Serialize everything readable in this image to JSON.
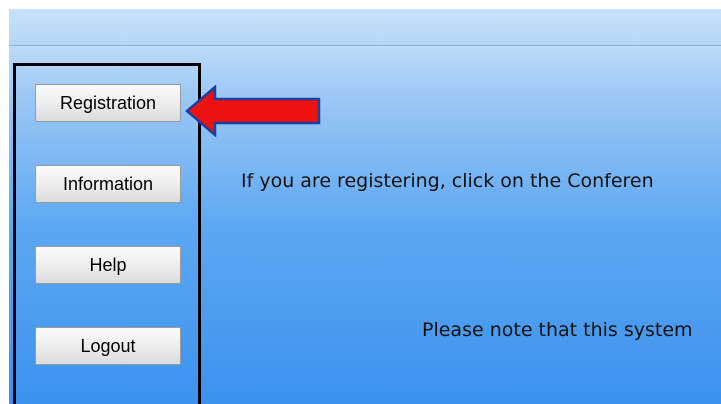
{
  "sidebar": {
    "buttons": {
      "registration": "Registration",
      "information": "Information",
      "help": "Help",
      "logout": "Logout"
    }
  },
  "main": {
    "message_1": "If you are registering, click on the Conferen",
    "message_2": "Please note that this system"
  },
  "colors": {
    "arrow_fill": "#ee1111",
    "arrow_stroke": "#1a3fa0",
    "sidebar_border": "#000000"
  }
}
